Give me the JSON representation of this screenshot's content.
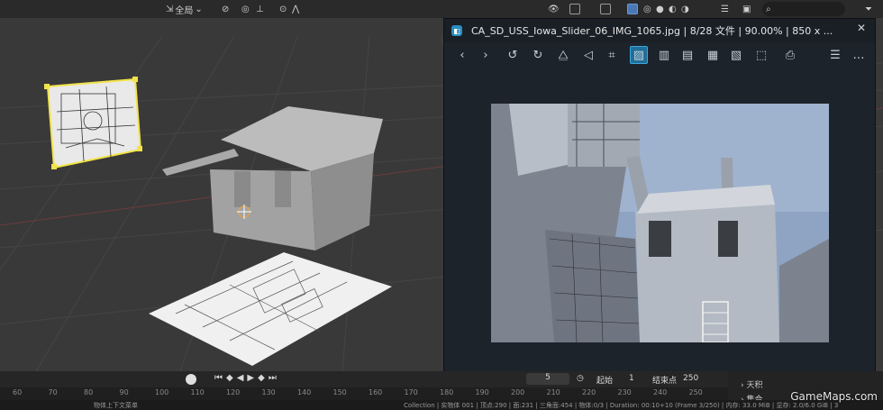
{
  "header": {
    "transform_orientation": "全局",
    "search_placeholder": ""
  },
  "viewer": {
    "title": "CA_SD_USS_Iowa_Slider_06_IMG_1065.jpg  |  8/28 文件  |  90.00%  |  850 x ...",
    "close_glyph": "✕"
  },
  "timeline": {
    "frame_current": "5",
    "start_label": "起始",
    "start_value": "1",
    "end_label": "结束点",
    "end_value": "250",
    "ticks": [
      "60",
      "70",
      "80",
      "90",
      "100",
      "110",
      "120",
      "130",
      "140",
      "150",
      "160",
      "170",
      "180",
      "190",
      "200",
      "210",
      "220",
      "230",
      "240",
      "250"
    ]
  },
  "outliner": {
    "items": [
      "天积",
      "集合"
    ]
  },
  "status": {
    "left": "物体上下文菜单",
    "right": "Collection | 实物体 001 | 顶点:290 | 面:231 | 三角面:454 | 物体:0/3 | Duration: 00:10+10 (Frame 3/250) | 内存: 33.0 MiB | 显存: 2.0/6.0 GiB | 3"
  },
  "watermark": "GameMaps.com",
  "colors": {
    "viewport_bg": "#393939",
    "accent_blue": "#2a8ec0",
    "selection_yellow": "#f2e34a"
  }
}
